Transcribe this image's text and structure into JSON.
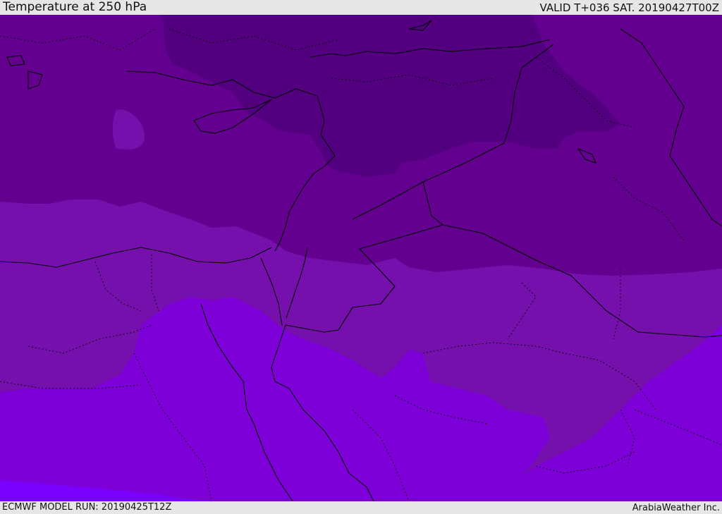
{
  "header": {
    "title": "Temperature at 250 hPa",
    "valid_label": "VALID T+036 SAT. 20190427T00Z"
  },
  "footer": {
    "model_run": "ECMWF MODEL RUN: 20190425T12Z",
    "credit": "ArabiaWeather Inc."
  },
  "colors": {
    "band_coldest": "#520080",
    "band_cold": "#64008f",
    "band_mid": "#7510ad",
    "band_warm": "#7d00d9",
    "band_warmest": "#7a00ff",
    "coastline": "#000000",
    "bar_background": "#e6e6e6"
  }
}
